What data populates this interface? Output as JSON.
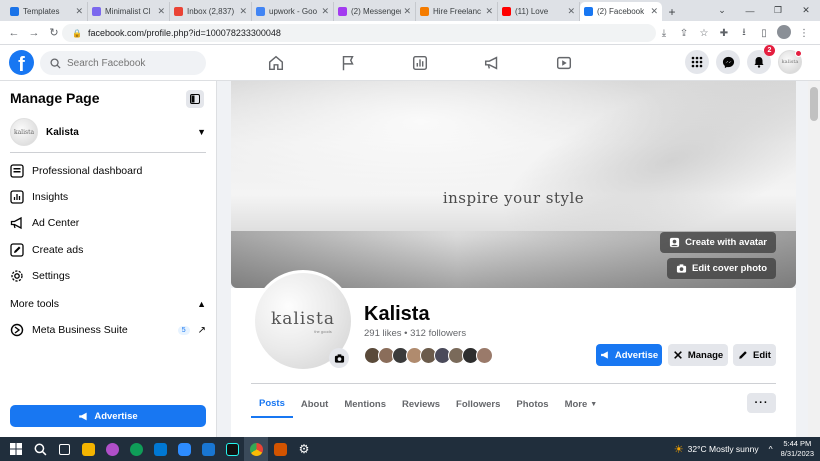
{
  "browser": {
    "tabs": [
      {
        "title": "Templates",
        "color": "#1a73e8",
        "active": false
      },
      {
        "title": "Minimalist Cl",
        "color": "#7b68ee",
        "active": false
      },
      {
        "title": "Inbox (2,837)",
        "color": "#ea4335",
        "active": false
      },
      {
        "title": "upwork - Goo",
        "color": "#4285f4",
        "active": false
      },
      {
        "title": "(2) Messenger",
        "color": "#a33bf0",
        "active": false
      },
      {
        "title": "Hire Freelanc",
        "color": "#f57c00",
        "active": false
      },
      {
        "title": "(11) Love",
        "color": "#ff0000",
        "active": false
      },
      {
        "title": "(2) Facebook",
        "color": "#1877f2",
        "active": true
      }
    ],
    "url": "facebook.com/profile.php?id=100078233300048"
  },
  "header": {
    "search_placeholder": "Search Facebook",
    "notif_count": "2",
    "avatar_text": "kalista"
  },
  "sidebar": {
    "title": "Manage Page",
    "page_name": "Kalista",
    "page_avatar_text": "kalista",
    "items": [
      {
        "label": "Professional dashboard"
      },
      {
        "label": "Insights"
      },
      {
        "label": "Ad Center"
      },
      {
        "label": "Create ads"
      },
      {
        "label": "Settings"
      }
    ],
    "more_tools": "More tools",
    "meta_suite": "Meta Business Suite",
    "meta_count": "5",
    "advertise": "Advertise"
  },
  "cover": {
    "text": "inspire your style",
    "create_avatar": "Create with avatar",
    "edit_cover": "Edit cover photo"
  },
  "profile": {
    "logo": "kalista",
    "logo_sub": "the goods",
    "name": "Kalista",
    "stats": "291 likes • 312 followers",
    "advertise": "Advertise",
    "manage": "Manage",
    "edit": "Edit",
    "follower_colors": [
      "#5a4a3a",
      "#8a6d5a",
      "#3b3b3b",
      "#b08b6e",
      "#6b5b4b",
      "#4a4a5a",
      "#7a6a5a",
      "#2e2e2e",
      "#9a7a6a"
    ]
  },
  "tabs": [
    "Posts",
    "About",
    "Mentions",
    "Reviews",
    "Followers",
    "Photos",
    "More"
  ],
  "taskbar": {
    "weather": "32°C  Mostly sunny",
    "time": "5:44 PM",
    "date": "8/31/2023"
  }
}
